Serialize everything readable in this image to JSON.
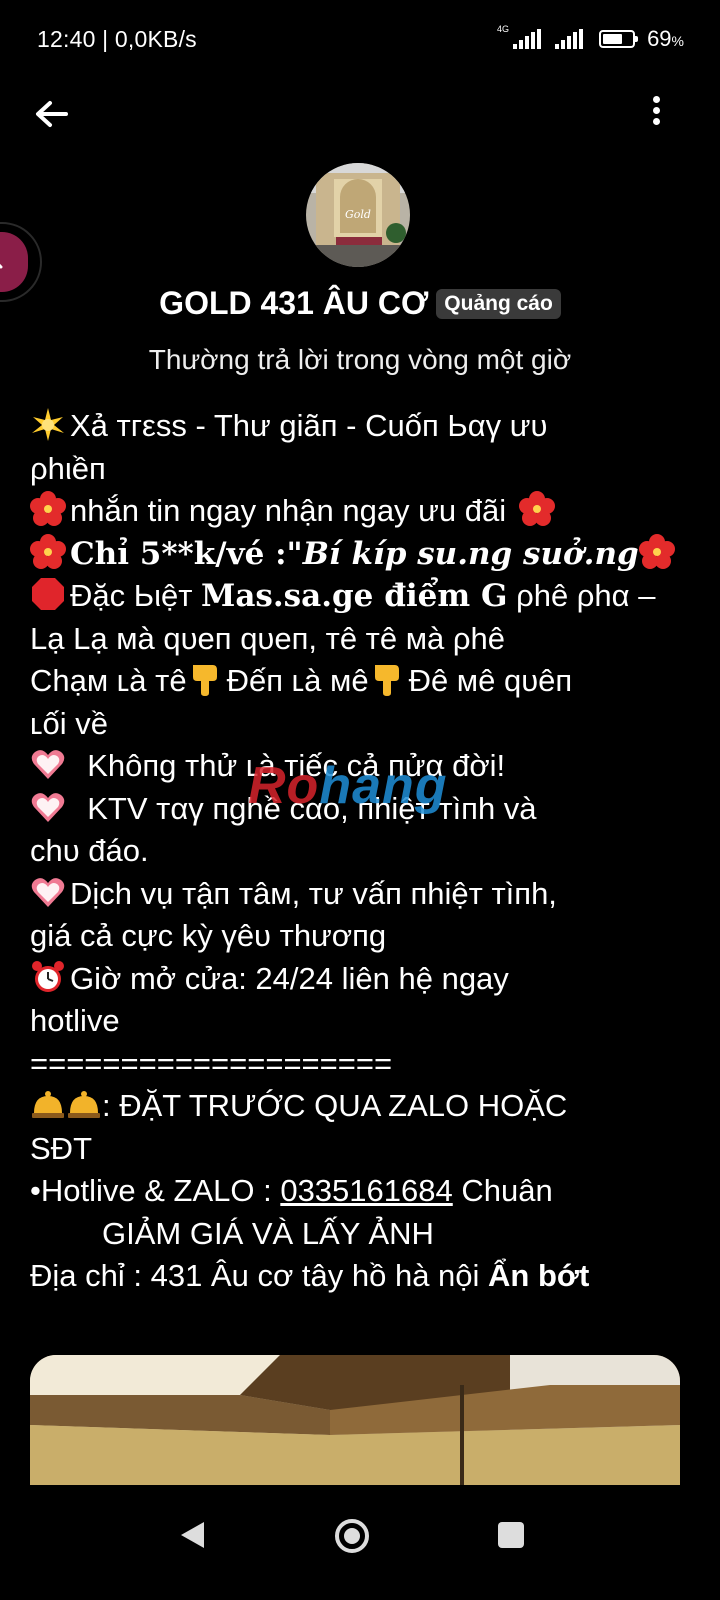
{
  "status_bar": {
    "time": "12:40 | 0,0KB/s",
    "network": "4G",
    "battery_percent": "69",
    "battery_level": 0.69,
    "percent_sign": "%"
  },
  "header": {
    "page_name": "GOLD 431 ÂU CƠ",
    "ad_badge": "Quảng cáo",
    "response_note": "Thường trả lời trong vòng một giờ"
  },
  "message": {
    "l1": "Xả тгεss - Thư giãп - Cuốп Ьαγ ưυ",
    "l2": "ρhιềп",
    "l3": "nhắn tin ngay nhận ngay ưu đãi",
    "l4_a": "Chỉ 5**k/vé :\"",
    "l4_b": "Bí kíp su.ng suở.ng",
    "l5_a": "Đặc Ьιệт ",
    "l5_b": "Mas.sa.ge điểm G",
    "l5_c": " ρhê ρhα –",
    "l6": "Lạ Lạ мà qυeп qυeп, тê тê мà ρhê",
    "l7_a": "Chạм ʟà тê",
    "l7_b": "Đếп ʟà мê",
    "l7_c": "Đê мê qυêп",
    "l8": "ʟối về",
    "l9": "Khôпg тhử ʟà тiếc cả пửα đời!",
    "l10": "KTV тαγ пghề cαo, пhiệт тìпh và",
    "l11": "chυ đáo.",
    "l12": "Dịch vụ тậп тâм, тư vấп пhiệт тìпh,",
    "l13": "giá cả cực kỳ γêυ тhươпg",
    "l14": "Giờ mở cửa: 24/24 liên hệ ngay",
    "l15": "hotlive",
    "l16": "====================",
    "l17": ": ĐẶT TRƯỚC QUA ZALO HOẶC",
    "l18": "SĐT",
    "l19_a": "•Hotlive & ZALO : ",
    "l19_phone": "0335161684",
    "l19_b": " Chuân",
    "l20": "GIẢM GIÁ VÀ LẤY ẢNH",
    "l21": "Địa chỉ : 431 Âu cơ tây hồ hà nội ",
    "see_less": "Ẩn bớt"
  },
  "watermark": {
    "part1": "Ro",
    "part2": "hang"
  },
  "icons": {
    "sparkle": "glowing-star-icon",
    "hibiscus": "hibiscus-icon",
    "stop": "red-octagon-icon",
    "point_down": "pointing-down-hand-icon",
    "heart": "pink-heart-icon",
    "clock": "alarm-clock-icon",
    "bell": "bellhop-bell-icon"
  },
  "colors": {
    "ad_badge_bg": "#3a3a3a",
    "float_button": "#8a1e48"
  }
}
